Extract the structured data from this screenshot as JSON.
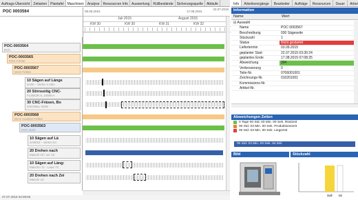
{
  "tabs_left": [
    "Auftrags-Übersicht",
    "Zeitarten",
    "Plantafel",
    "Maschinen",
    "Analyse",
    "Ressourcen Info",
    "Auswertung",
    "Rüllbestände",
    "Sicherungsquelle",
    "Abläufe"
  ],
  "tabs_right": [
    "Info",
    "Arbeitsvorgänge",
    "Bearbeiter",
    "Aufträge",
    "Ressourcen",
    "Dauer",
    "Arbeitsplätze"
  ],
  "order_title": "POC 0003564",
  "timeline": {
    "months": [
      "Juli 2015",
      "August 2015"
    ],
    "week_labels": [
      "KW 30",
      "KW 30",
      "KW 31",
      "KW 32"
    ],
    "dates_left": "08.08.2015",
    "dates_right": "17.08.2015",
    "top_right_date": "22.07.2015"
  },
  "tree": [
    {
      "id": "POC-0003564",
      "sub": "BVC",
      "style": "grey"
    },
    {
      "id": "POC-0003565",
      "sub": "POC Fehler",
      "style": "orange"
    },
    {
      "id": "POC-0003567",
      "sub": "WAS Fehler",
      "style": "orange"
    },
    {
      "id": "10 Sägen auf Länge",
      "sub": "SAW – Verter 4 ABA",
      "style": "grey"
    },
    {
      "id": "20 Stirnseitig CNC-",
      "sub": "FLSBOR 9, 2480KA",
      "style": "grey"
    },
    {
      "id": "30 CNC-Fräsen, Bo",
      "sub": "CNCMILL 0038",
      "style": "grey"
    },
    {
      "id": "POC-0003568",
      "sub": "WAS Auslöse Fehler",
      "style": "orange"
    },
    {
      "id": "POC-0003563",
      "sub": "POC Dreh",
      "style": "blue"
    },
    {
      "id": "10 Sägen auf Lä",
      "sub": "SAW10 – Verter KA",
      "style": "grey"
    },
    {
      "id": "20 Drehen nach",
      "sub": "Maschi Ol / ver 10",
      "style": "grey"
    },
    {
      "id": "10 Sägen auf Läng:",
      "sub": "Mascho 7L - Laue 7C",
      "style": "grey"
    },
    {
      "id": "20 Drehen nach Zei",
      "sub": "Maschi 10",
      "style": "grey"
    }
  ],
  "status_text": "27.07.2015 04:09:50",
  "info": {
    "title": "Information",
    "col_name": "Name",
    "col_value": "Wert",
    "group": "Auswahl",
    "rows": [
      {
        "k": "Name",
        "v": "POC 0003567",
        "hl": ""
      },
      {
        "k": "Beschreibung",
        "v": "030 Sägeseite",
        "hl": ""
      },
      {
        "k": "Stückzahl",
        "v": "1",
        "hl": ""
      },
      {
        "k": "Status",
        "v": "Nicht gestartet",
        "hl": "red"
      },
      {
        "k": "Liefertermin",
        "v": "03.09.2015",
        "hl": ""
      },
      {
        "k": "geplanter Start",
        "v": "22.07.2015 03:30:24",
        "hl": ""
      },
      {
        "k": "geplantes Ende",
        "v": "17.08.2015 07:08:25",
        "hl": ""
      },
      {
        "k": "Abweichung",
        "v": "394",
        "hl": "grn"
      },
      {
        "k": "Verbesserung",
        "v": "0",
        "hl": ""
      },
      {
        "k": "Teile-Nr.",
        "v": "0706001001",
        "hl": ""
      },
      {
        "k": "Zeichnungs-Nr.",
        "v": "010201001",
        "hl": ""
      },
      {
        "k": "Kommissions-Nr.",
        "v": "",
        "hl": ""
      },
      {
        "k": "Artikel-Nr.",
        "v": "",
        "hl": ""
      }
    ]
  },
  "work": {
    "title": "Abweichungen Zeiten",
    "rows": [
      {
        "color": "#6cc04a",
        "text": "0 Tage 00 Std. 00 Min. 00 Sek. Rüstzeit"
      },
      {
        "color": "#e3873a",
        "text": "00 Std. 03 Min. 00 Sek. Produktionszeit"
      },
      {
        "color": "#e53b3b",
        "text": "00 Std. 03 Min. 00 Sek. Liegezeit"
      }
    ],
    "bar_text": "00 Std. 03 Min. 03 Sek. Ist Zeit"
  },
  "bild_title": "Bild",
  "stueck_title": "Stückzahl",
  "stueck_labels": [
    "Soll",
    "Ist"
  ],
  "colors": {
    "accent": "#2a64b4",
    "green": "#6cc04a",
    "orange": "#f6c986",
    "red": "#e53b3b"
  }
}
